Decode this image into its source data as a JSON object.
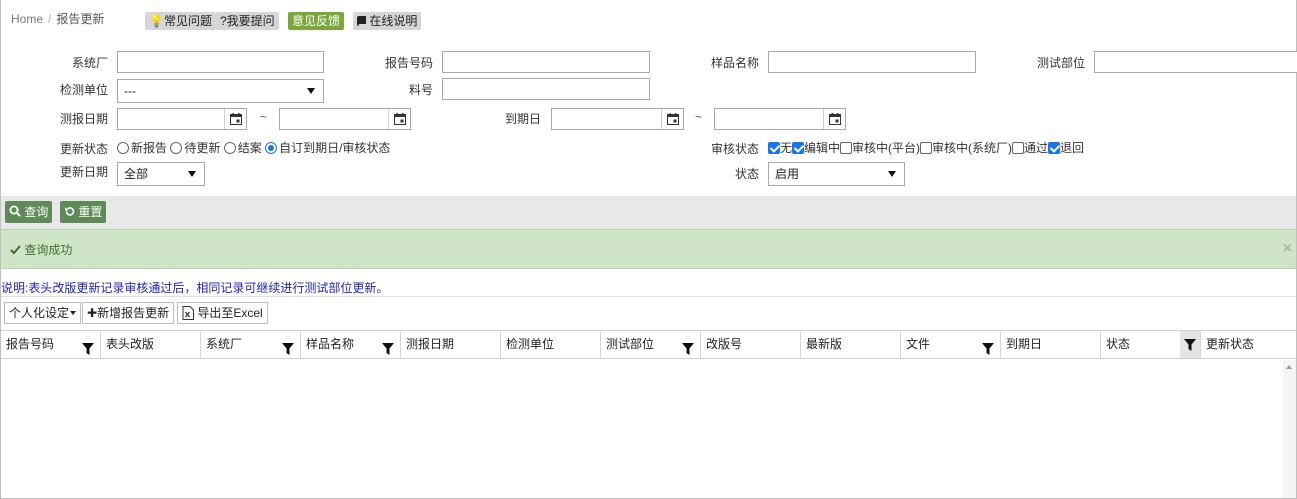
{
  "breadcrumb": {
    "home": "Home",
    "separator": "/",
    "current": "报告更新"
  },
  "top_buttons": {
    "faq": "常见问题",
    "ask": "?我要提问",
    "feedback": "意见反馈",
    "manual": "在线说明"
  },
  "form": {
    "system_factory": {
      "label": "系统厂",
      "value": ""
    },
    "report_no": {
      "label": "报告号码",
      "value": ""
    },
    "sample_name": {
      "label": "样品名称",
      "value": ""
    },
    "test_dept": {
      "label": "测试部位",
      "value": ""
    },
    "test_unit": {
      "label": "检测单位",
      "value": "---"
    },
    "part_no": {
      "label": "料号",
      "value": ""
    },
    "report_date": {
      "label": "测报日期",
      "from": "",
      "to": "",
      "tilde": "~"
    },
    "due_date": {
      "label": "到期日",
      "from": "",
      "to": "",
      "tilde": "~"
    },
    "update_status": {
      "label": "更新状态",
      "options": [
        "新报告",
        "待更新",
        "结案",
        "自订到期日/审核状态"
      ],
      "selected": "自订到期日/审核状态"
    },
    "review_status": {
      "label": "审核状态",
      "options": [
        {
          "label": "无",
          "checked": true
        },
        {
          "label": "编辑中",
          "checked": true
        },
        {
          "label": "审核中(平台)",
          "checked": false
        },
        {
          "label": "审核中(系统厂)",
          "checked": false
        },
        {
          "label": "通过",
          "checked": false
        },
        {
          "label": "退回",
          "checked": true
        }
      ]
    },
    "update_date": {
      "label": "更新日期",
      "value": "全部"
    },
    "status": {
      "label": "状态",
      "value": "启用"
    }
  },
  "actions": {
    "query": "查询",
    "reset": "重置"
  },
  "alert": {
    "message": "查询成功",
    "close": "×"
  },
  "note": "说明:表头改版更新记录审核通过后，相同记录可继续进行测试部位更新。",
  "grid_toolbar": {
    "personalize": "个人化设定",
    "add_update": "新增报告更新",
    "export": "导出至Excel"
  },
  "columns": [
    {
      "label": "报告号码",
      "filter": true
    },
    {
      "label": "表头改版",
      "filter": false
    },
    {
      "label": "系统厂",
      "filter": true
    },
    {
      "label": "样品名称",
      "filter": true
    },
    {
      "label": "测报日期",
      "filter": false
    },
    {
      "label": "检测单位",
      "filter": false
    },
    {
      "label": "测试部位",
      "filter": true
    },
    {
      "label": "改版号",
      "filter": false
    },
    {
      "label": "最新版",
      "filter": false
    },
    {
      "label": "文件",
      "filter": true
    },
    {
      "label": "到期日",
      "filter": false
    },
    {
      "label": "状态",
      "filter": true
    },
    {
      "label": "更新状态",
      "filter": false
    }
  ],
  "colors": {
    "accent_blue": "#1a73e8",
    "button_green": "#5d8a57",
    "feedback_green": "#7aa63b",
    "alert_bg": "#d0e5c8",
    "note_blue": "#2222bb"
  }
}
